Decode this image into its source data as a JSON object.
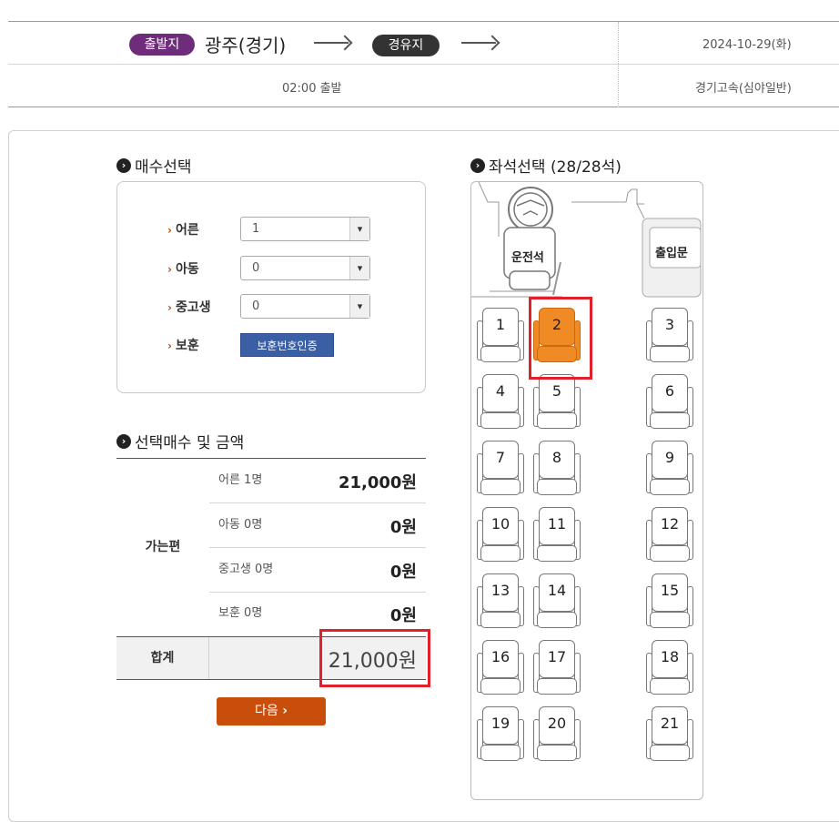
{
  "route": {
    "departure_badge": "출발지",
    "departure_city": "광주(경기)",
    "via_badge": "경유지",
    "date": "2024-10-29(화)",
    "departure_time": "02:00 출발",
    "bus_company": "경기고속(심야일반)"
  },
  "count_section": {
    "title": "매수선택",
    "rows": [
      {
        "label": "어른",
        "value": "1"
      },
      {
        "label": "아동",
        "value": "0"
      },
      {
        "label": "중고생",
        "value": "0"
      }
    ],
    "veteran_label": "보훈",
    "veteran_button": "보훈번호인증"
  },
  "price_section": {
    "title": "선택매수 및 금액",
    "group_label": "가는편",
    "rows": [
      {
        "label": "어른 1명",
        "value": "21,000원"
      },
      {
        "label": "아동 0명",
        "value": "0원"
      },
      {
        "label": "중고생 0명",
        "value": "0원"
      },
      {
        "label": "보훈 0명",
        "value": "0원"
      }
    ],
    "total_label": "합계",
    "total_value": "21,000원"
  },
  "next_button": "다음",
  "seat_section": {
    "title": "좌석선택 (28/28석)",
    "driver_label": "운전석",
    "door_label": "출입문",
    "selected_seat": "2",
    "seats": [
      "1",
      "2",
      "3",
      "4",
      "5",
      "6",
      "7",
      "8",
      "9",
      "10",
      "11",
      "12",
      "13",
      "14",
      "15",
      "16",
      "17",
      "18",
      "19",
      "20",
      "21"
    ]
  },
  "colors": {
    "accent_purple": "#6e2c7a",
    "selected_seat": "#f08a24",
    "next_button": "#c94e0b",
    "veteran_button": "#3a5fa5",
    "highlight_box": "#e0202a"
  }
}
